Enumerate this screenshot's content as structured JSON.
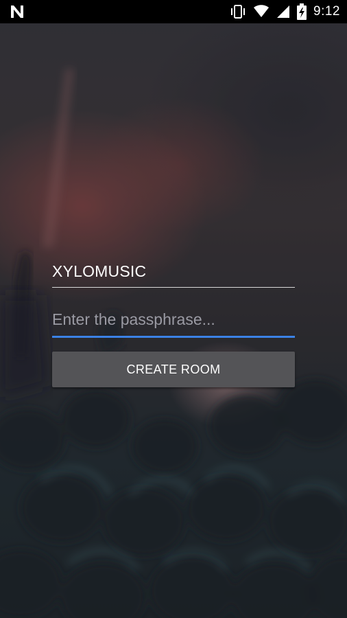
{
  "status_bar": {
    "time": "9:12",
    "icons": [
      "n-logo-icon",
      "vibrate-icon",
      "wifi-icon",
      "signal-icon",
      "battery-charging-icon"
    ]
  },
  "form": {
    "room_name": "XYLOMUSIC",
    "passphrase": {
      "value": "",
      "placeholder": "Enter the passphrase..."
    },
    "create_button_label": "CREATE ROOM"
  },
  "colors": {
    "accent": "#3b82e6",
    "button_bg": "#545457",
    "status_bar_bg": "#000000",
    "text": "#ffffff",
    "placeholder": "#9a9aa3"
  }
}
